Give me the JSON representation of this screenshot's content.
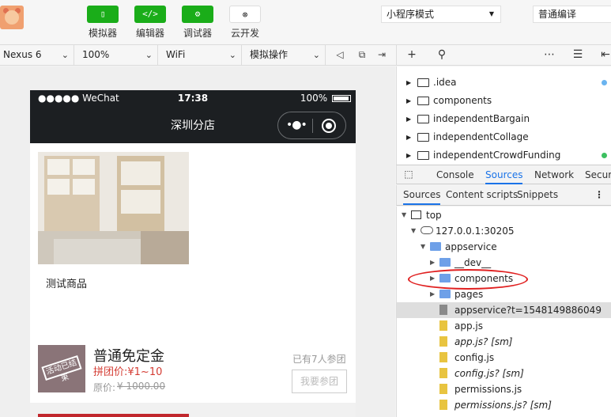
{
  "toolbar": {
    "buttons": [
      {
        "label": "模拟器",
        "icon": "phone-icon",
        "glyph": "▯"
      },
      {
        "label": "编辑器",
        "icon": "code-icon",
        "glyph": "</>"
      },
      {
        "label": "调试器",
        "icon": "debug-icon",
        "glyph": "⚙"
      },
      {
        "label": "云开发",
        "icon": "cloud-link-icon",
        "glyph": "⊗"
      }
    ],
    "mode_select": "小程序模式",
    "compile_select": "普通编译"
  },
  "device_bar": {
    "device": "Nexus 6",
    "zoom": "100%",
    "network": "WiFi",
    "operation": "模拟操作"
  },
  "phone": {
    "status": {
      "signal": "●●●●● WeChat",
      "time": "17:38",
      "battery": "100%"
    },
    "nav_title": "深圳分店",
    "product_name": "测试商品",
    "group": {
      "stamp": "活动已结束",
      "title": "普通免定金",
      "price": "拼团价:¥1~10",
      "orig_label": "原价:",
      "orig_price": "¥ 1000.00",
      "joined": "已有7人参团",
      "join_button": "我要参团"
    }
  },
  "file_tree": [
    {
      "name": ".idea",
      "dot": "#6ab4f0"
    },
    {
      "name": "components",
      "dot": ""
    },
    {
      "name": "independentBargain",
      "dot": ""
    },
    {
      "name": "independentCollage",
      "dot": ""
    },
    {
      "name": "independentCrowdFunding",
      "dot": "#3cc060"
    }
  ],
  "devtools": {
    "tabs": [
      "Console",
      "Sources",
      "Network",
      "Securit"
    ],
    "active_tab": "Sources",
    "source_tabs": [
      "Sources",
      "Content scripts",
      "Snippets"
    ],
    "nav_tree": [
      {
        "name": "top",
        "level": 0,
        "arrow": "▼",
        "icon": "frame",
        "italic": false,
        "selected": false
      },
      {
        "name": "127.0.0.1:30205",
        "level": 1,
        "arrow": "▼",
        "icon": "cloud",
        "italic": false,
        "selected": false
      },
      {
        "name": "appservice",
        "level": 2,
        "arrow": "▼",
        "icon": "bfolder",
        "italic": false,
        "selected": false
      },
      {
        "name": "__dev__",
        "level": 3,
        "arrow": "▶",
        "icon": "bfolder",
        "italic": false,
        "selected": false
      },
      {
        "name": "components",
        "level": 3,
        "arrow": "▶",
        "icon": "bfolder",
        "italic": false,
        "selected": false
      },
      {
        "name": "pages",
        "level": 3,
        "arrow": "▶",
        "icon": "bfolder",
        "italic": false,
        "selected": false
      },
      {
        "name": "appservice?t=1548149886049",
        "level": 3,
        "arrow": "",
        "icon": "gfile",
        "italic": false,
        "selected": true
      },
      {
        "name": "app.js",
        "level": 3,
        "arrow": "",
        "icon": "yfile",
        "italic": false,
        "selected": false
      },
      {
        "name": "app.js? [sm]",
        "level": 3,
        "arrow": "",
        "icon": "yfile",
        "italic": true,
        "selected": false
      },
      {
        "name": "config.js",
        "level": 3,
        "arrow": "",
        "icon": "yfile",
        "italic": false,
        "selected": false
      },
      {
        "name": "config.js? [sm]",
        "level": 3,
        "arrow": "",
        "icon": "yfile",
        "italic": true,
        "selected": false
      },
      {
        "name": "permissions.js",
        "level": 3,
        "arrow": "",
        "icon": "yfile",
        "italic": false,
        "selected": false
      },
      {
        "name": "permissions.js? [sm]",
        "level": 3,
        "arrow": "",
        "icon": "yfile",
        "italic": true,
        "selected": false
      }
    ]
  }
}
